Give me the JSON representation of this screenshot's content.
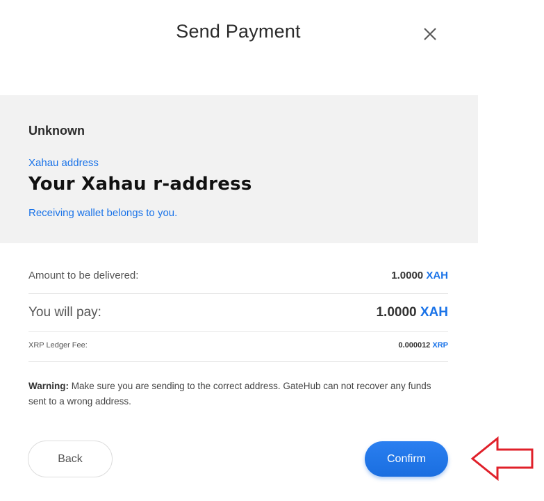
{
  "modal": {
    "title": "Send Payment"
  },
  "recipient": {
    "name": "Unknown",
    "address_label": "Xahau address",
    "address_value": "Your Xahau r-address",
    "ownership_note": "Receiving wallet belongs to you."
  },
  "summary": {
    "amount": {
      "label": "Amount to be delivered:",
      "value": "1.0000",
      "currency": "XAH"
    },
    "pay": {
      "label": "You will pay:",
      "value": "1.0000",
      "currency": "XAH"
    },
    "fee": {
      "label": "XRP Ledger Fee:",
      "value": "0.000012",
      "currency": "XRP"
    }
  },
  "warning": {
    "prefix": "Warning:",
    "text": "Make sure you are sending to the correct address. GateHub can not recover any funds sent to a wrong address."
  },
  "actions": {
    "back_label": "Back",
    "confirm_label": "Confirm"
  },
  "icons": {
    "close": "close-icon",
    "annotation": "red-arrow-icon"
  },
  "colors": {
    "accent": "#1a73e8",
    "confirm_button": "#1a6ee0",
    "panel_background": "#f2f2f2",
    "annotation": "#e0202a"
  }
}
